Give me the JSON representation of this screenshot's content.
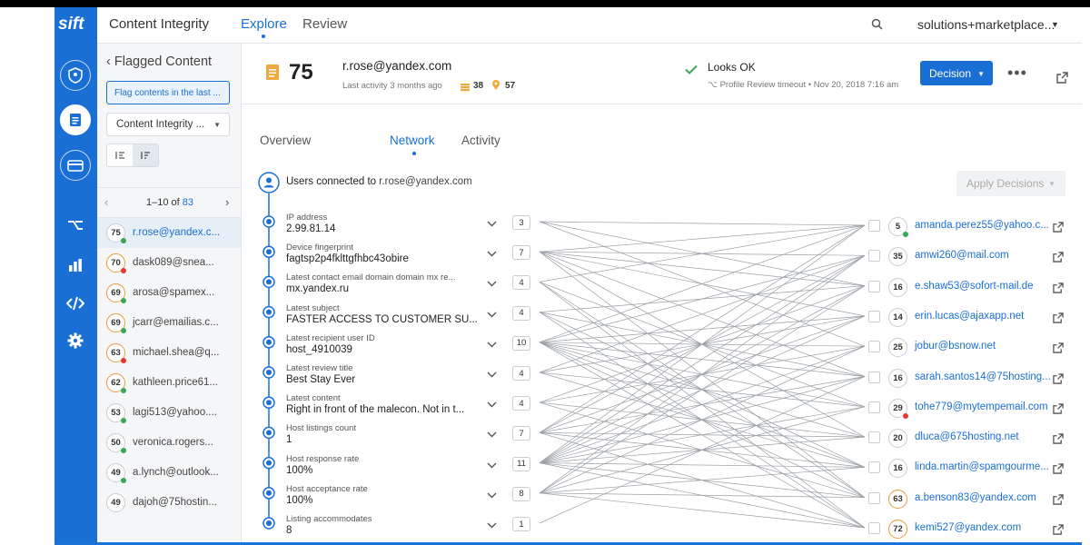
{
  "app": {
    "logo": "sift",
    "title": "Content Integrity"
  },
  "nav": {
    "explore": "Explore",
    "review": "Review"
  },
  "account": {
    "label": "solutions+marketplace..."
  },
  "rail": {
    "icons": [
      "shield-icon",
      "document-icon",
      "card-icon",
      "workflow-icon",
      "bar-chart-icon",
      "code-icon",
      "gear-icon"
    ]
  },
  "list_panel": {
    "back_label": "Flagged Content",
    "filter_label": "Flag contents in the last ...",
    "dropdown_value": "Content Integrity ...",
    "pager": {
      "range": "1–10 of ",
      "total": "83"
    },
    "items": [
      {
        "score": "75",
        "email": "r.rose@yandex.c...",
        "score_color": "#c9ccd1",
        "dot": "#3aa757"
      },
      {
        "score": "70",
        "email": "dask089@snea...",
        "score_color": "#e79a3a",
        "dot": "#e53935"
      },
      {
        "score": "69",
        "email": "arosa@spamex...",
        "score_color": "#e79a3a",
        "dot": "#3aa757"
      },
      {
        "score": "69",
        "email": "jcarr@emailias.c...",
        "score_color": "#e79a3a",
        "dot": "#3aa757"
      },
      {
        "score": "63",
        "email": "michael.shea@q...",
        "score_color": "#e79a3a",
        "dot": "#e53935"
      },
      {
        "score": "62",
        "email": "kathleen.price61...",
        "score_color": "#e79a3a",
        "dot": "#3aa757"
      },
      {
        "score": "53",
        "email": "lagi513@yahoo....",
        "score_color": "#c9ccd1",
        "dot": "#3aa757"
      },
      {
        "score": "50",
        "email": "veronica.rogers...",
        "score_color": "#c9ccd1",
        "dot": "#3aa757"
      },
      {
        "score": "49",
        "email": "a.lynch@outlook...",
        "score_color": "#c9ccd1",
        "dot": "#3aa757"
      },
      {
        "score": "49",
        "email": "dajoh@75hostin...",
        "score_color": "#c9ccd1",
        "dot": ""
      }
    ]
  },
  "user": {
    "score": "75",
    "email": "r.rose@yandex.com",
    "last_activity": "Last activity 3 months ago",
    "stat_a": "38",
    "stat_b": "57",
    "status": "Looks OK",
    "status_detail": "Profile Review timeout • Nov 20, 2018 7:16 am",
    "decision_label": "Decision",
    "more_label": "•••"
  },
  "tabs": {
    "overview": "Overview",
    "network": "Network",
    "activity": "Activity"
  },
  "network": {
    "connected_label": "Users connected to ",
    "connected_email": "r.rose@yandex.com",
    "apply_label": "Apply Decisions",
    "attributes": [
      {
        "label": "IP address",
        "value": "2.99.81.14",
        "count": "3"
      },
      {
        "label": "Device fingerprint",
        "value": "fagtsp2p4fklttgfhbc43obire",
        "count": "7"
      },
      {
        "label": "Latest contact email domain domain mx re...",
        "value": "mx.yandex.ru",
        "count": "4"
      },
      {
        "label": "Latest subject",
        "value": "FASTER ACCESS TO CUSTOMER SU...",
        "count": "4"
      },
      {
        "label": "Latest recipient user ID",
        "value": "host_4910039",
        "count": "10"
      },
      {
        "label": "Latest review title",
        "value": "Best Stay Ever",
        "count": "4"
      },
      {
        "label": "Latest content",
        "value": "Right in front of the malecon. Not in t...",
        "count": "4"
      },
      {
        "label": "Host listings count",
        "value": "1",
        "count": "7"
      },
      {
        "label": "Host response rate",
        "value": "100%",
        "count": "11"
      },
      {
        "label": "Host acceptance rate",
        "value": "100%",
        "count": "8"
      },
      {
        "label": "Listing accommodates",
        "value": "8",
        "count": "1"
      }
    ],
    "users": [
      {
        "score": "5",
        "email": "amanda.perez55@yahoo.c...",
        "score_color": "#c9ccd1",
        "dot": "#3aa757"
      },
      {
        "score": "35",
        "email": "amwi260@mail.com",
        "score_color": "#c9ccd1",
        "dot": ""
      },
      {
        "score": "16",
        "email": "e.shaw53@sofort-mail.de",
        "score_color": "#c9ccd1",
        "dot": ""
      },
      {
        "score": "14",
        "email": "erin.lucas@ajaxapp.net",
        "score_color": "#c9ccd1",
        "dot": ""
      },
      {
        "score": "25",
        "email": "jobur@bsnow.net",
        "score_color": "#c9ccd1",
        "dot": ""
      },
      {
        "score": "16",
        "email": "sarah.santos14@75hosting...",
        "score_color": "#c9ccd1",
        "dot": ""
      },
      {
        "score": "29",
        "email": "tohe779@mytempemail.com",
        "score_color": "#c9ccd1",
        "dot": "#e53935"
      },
      {
        "score": "20",
        "email": "dluca@675hosting.net",
        "score_color": "#c9ccd1",
        "dot": ""
      },
      {
        "score": "16",
        "email": "linda.martin@spamgourme...",
        "score_color": "#c9ccd1",
        "dot": ""
      },
      {
        "score": "63",
        "email": "a.benson83@yandex.com",
        "score_color": "#e79a3a",
        "dot": ""
      },
      {
        "score": "72",
        "email": "kemi527@yandex.com",
        "score_color": "#e79a3a",
        "dot": ""
      }
    ],
    "links": [
      [
        0,
        0
      ],
      [
        0,
        2
      ],
      [
        0,
        4
      ],
      [
        1,
        0
      ],
      [
        1,
        1
      ],
      [
        1,
        2
      ],
      [
        1,
        3
      ],
      [
        1,
        5
      ],
      [
        1,
        7
      ],
      [
        1,
        9
      ],
      [
        2,
        0
      ],
      [
        2,
        9
      ],
      [
        2,
        10
      ],
      [
        2,
        6
      ],
      [
        3,
        2
      ],
      [
        3,
        5
      ],
      [
        3,
        8
      ],
      [
        3,
        10
      ],
      [
        4,
        0
      ],
      [
        4,
        1
      ],
      [
        4,
        3
      ],
      [
        4,
        4
      ],
      [
        4,
        5
      ],
      [
        4,
        6
      ],
      [
        4,
        7
      ],
      [
        4,
        8
      ],
      [
        4,
        9
      ],
      [
        4,
        10
      ],
      [
        5,
        1
      ],
      [
        5,
        3
      ],
      [
        5,
        6
      ],
      [
        5,
        8
      ],
      [
        6,
        2
      ],
      [
        6,
        4
      ],
      [
        6,
        7
      ],
      [
        6,
        9
      ],
      [
        7,
        0
      ],
      [
        7,
        1
      ],
      [
        7,
        3
      ],
      [
        7,
        5
      ],
      [
        7,
        7
      ],
      [
        7,
        8
      ],
      [
        7,
        10
      ],
      [
        8,
        0
      ],
      [
        8,
        1
      ],
      [
        8,
        2
      ],
      [
        8,
        3
      ],
      [
        8,
        4
      ],
      [
        8,
        5
      ],
      [
        8,
        6
      ],
      [
        8,
        7
      ],
      [
        8,
        8
      ],
      [
        8,
        9
      ],
      [
        8,
        10
      ],
      [
        9,
        1
      ],
      [
        9,
        2
      ],
      [
        9,
        4
      ],
      [
        9,
        6
      ],
      [
        9,
        8
      ],
      [
        9,
        9
      ],
      [
        9,
        10
      ],
      [
        10,
        5
      ]
    ]
  },
  "colors": {
    "brand": "#1a6fd4",
    "rail": "#1a6fd4",
    "warning": "#e79a3a",
    "ok": "#3aa757",
    "alert": "#e53935"
  }
}
